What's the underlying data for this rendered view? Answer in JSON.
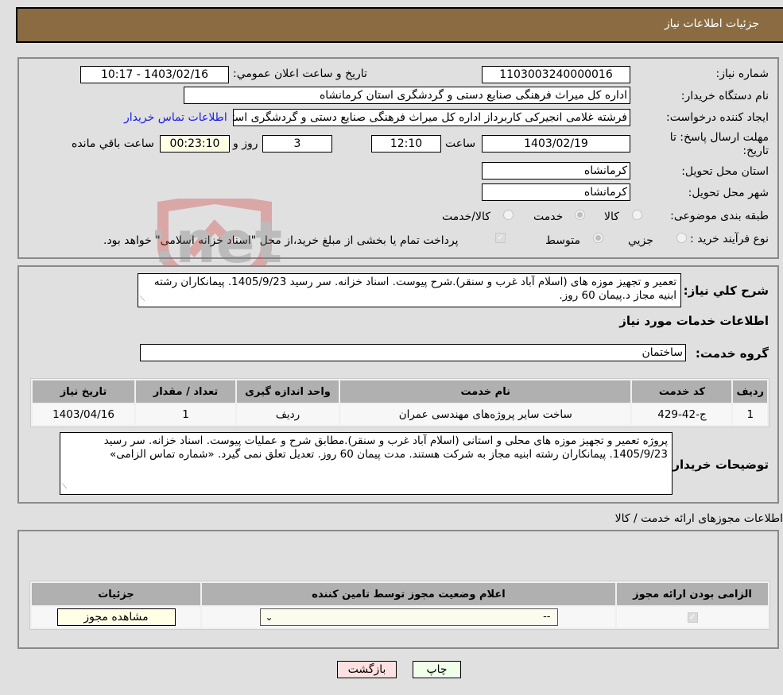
{
  "header": {
    "title": "جزئیات اطلاعات نیاز"
  },
  "details": {
    "need_number": {
      "label": "شماره نیاز:",
      "value": "1103003240000016"
    },
    "announce_datetime": {
      "label": "تاریخ و ساعت اعلان عمومي:",
      "value": "1403/02/16 - 10:17"
    },
    "buyer_org": {
      "label": "نام دستگاه خریدار:",
      "value": "اداره کل میراث فرهنگی  صنایع دستی و گردشگری استان کرمانشاه"
    },
    "requester": {
      "label": "ایجاد کننده درخواست:",
      "value": "فرشته غلامی انجیرکی کاربرداز اداره کل میراث فرهنگی  صنایع دستی و گردشگری استان کرمانشاه"
    },
    "buyer_contact_link": "اطلاعات تماس خریدار",
    "deadline": {
      "label": "مهلت ارسال پاسخ: تا تاریخ:",
      "date": "1403/02/19",
      "time_label": "ساعت",
      "time": "12:10",
      "days": "3",
      "days_label": "روز و",
      "remaining": "00:23:10",
      "remaining_label": "ساعت باقي مانده"
    },
    "delivery_province": {
      "label": "استان محل تحویل:",
      "value": "کرمانشاه"
    },
    "delivery_city": {
      "label": "شهر محل تحویل:",
      "value": "کرمانشاه"
    },
    "category": {
      "label": "طبقه بندی موضوعی:",
      "options": [
        "کالا",
        "خدمت",
        "کالا/خدمت"
      ],
      "selected": "خدمت"
    },
    "purchase_type": {
      "label": "نوع فرآیند خرید :",
      "options": [
        "جزیي",
        "متوسط"
      ],
      "selected": "متوسط",
      "treasury_checkbox_label": "پرداخت تمام یا بخشی از مبلغ خرید،از محل \"اسناد خزانه اسلامی\" خواهد بود.",
      "treasury_checked": true
    }
  },
  "summary": {
    "label": "شرح کلي نیاز:",
    "text": "تعمیر و تجهیز موزه های  (اسلام آباد غرب و سنقر).شرح  پیوست. اسناد خزانه. سر رسید 1405/9/23. پیمانکاران رشته ابنیه مجاز د.پیمان 60 روز."
  },
  "services_section": {
    "title": "اطلاعات خدمات مورد نیاز",
    "group_label": "گروه خدمت:",
    "group_value": "ساختمان",
    "table": {
      "headers": [
        "ردیف",
        "کد خدمت",
        "نام خدمت",
        "واحد اندازه گیری",
        "تعداد / مقدار",
        "تاریخ نیاز"
      ],
      "rows": [
        [
          "1",
          "ج-42-429",
          "ساخت سایر پروژه‌های مهندسی عمران",
          "ردیف",
          "1",
          "1403/04/16"
        ]
      ]
    }
  },
  "buyer_notes": {
    "label": "توضیحات خریدار:",
    "text": "پروژه تعمیر و تجهیز موزه های محلی و استانی (اسلام آباد غرب و سنقر).مطابق شرح و عملیات پیوست. اسناد خزانه. سر رسید 1405/9/23. پیمانکاران رشته ابنیه مجاز به شرکت هستند. مدت پیمان 60 روز. تعدیل تعلق نمی گیرد. «شماره تماس الزامی»"
  },
  "permits_section": {
    "title": "اطلاعات مجوزهای ارائه خدمت / کالا",
    "table": {
      "headers": [
        "الزامی بودن ارائه مجوز",
        "اعلام وضعیت مجوز توسط تامین کننده",
        "جزئیات"
      ],
      "row": {
        "required_checked": true,
        "status_value": "--",
        "details_button": "مشاهده مجوز"
      }
    }
  },
  "footer": {
    "print_button": "چاپ",
    "back_button": "بازگشت"
  },
  "watermark": {
    "text": "AriaTender.net"
  },
  "colors": {
    "header_bg": "#8b6c42",
    "link": "#1a1aee",
    "print_btn_bg": "#efffea",
    "back_btn_bg": "#ffe0e0",
    "yellow_field": "#ffffe6"
  }
}
